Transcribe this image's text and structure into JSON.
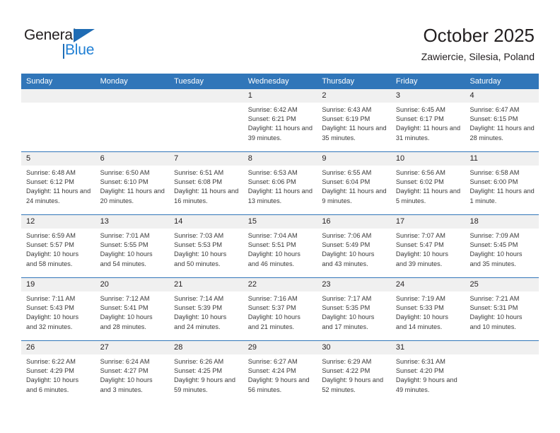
{
  "brand": {
    "word_one": "General",
    "word_two": "Blue",
    "accent_color": "#1f7fd4",
    "triangle_color": "#1f6cb4",
    "logo_icon": "triangle-icon"
  },
  "header": {
    "title": "October 2025",
    "subtitle": "Zawiercie, Silesia, Poland"
  },
  "calendar": {
    "header_bg": "#3176b9",
    "daynum_bg": "#f0f0f0",
    "weekdays": [
      "Sunday",
      "Monday",
      "Tuesday",
      "Wednesday",
      "Thursday",
      "Friday",
      "Saturday"
    ],
    "weeks": [
      [
        {
          "day": "",
          "sunrise": "",
          "sunset": "",
          "daylight": "",
          "empty": true
        },
        {
          "day": "",
          "sunrise": "",
          "sunset": "",
          "daylight": "",
          "empty": true
        },
        {
          "day": "",
          "sunrise": "",
          "sunset": "",
          "daylight": "",
          "empty": true
        },
        {
          "day": "1",
          "sunrise": "Sunrise: 6:42 AM",
          "sunset": "Sunset: 6:21 PM",
          "daylight": "Daylight: 11 hours and 39 minutes."
        },
        {
          "day": "2",
          "sunrise": "Sunrise: 6:43 AM",
          "sunset": "Sunset: 6:19 PM",
          "daylight": "Daylight: 11 hours and 35 minutes."
        },
        {
          "day": "3",
          "sunrise": "Sunrise: 6:45 AM",
          "sunset": "Sunset: 6:17 PM",
          "daylight": "Daylight: 11 hours and 31 minutes."
        },
        {
          "day": "4",
          "sunrise": "Sunrise: 6:47 AM",
          "sunset": "Sunset: 6:15 PM",
          "daylight": "Daylight: 11 hours and 28 minutes."
        }
      ],
      [
        {
          "day": "5",
          "sunrise": "Sunrise: 6:48 AM",
          "sunset": "Sunset: 6:12 PM",
          "daylight": "Daylight: 11 hours and 24 minutes."
        },
        {
          "day": "6",
          "sunrise": "Sunrise: 6:50 AM",
          "sunset": "Sunset: 6:10 PM",
          "daylight": "Daylight: 11 hours and 20 minutes."
        },
        {
          "day": "7",
          "sunrise": "Sunrise: 6:51 AM",
          "sunset": "Sunset: 6:08 PM",
          "daylight": "Daylight: 11 hours and 16 minutes."
        },
        {
          "day": "8",
          "sunrise": "Sunrise: 6:53 AM",
          "sunset": "Sunset: 6:06 PM",
          "daylight": "Daylight: 11 hours and 13 minutes."
        },
        {
          "day": "9",
          "sunrise": "Sunrise: 6:55 AM",
          "sunset": "Sunset: 6:04 PM",
          "daylight": "Daylight: 11 hours and 9 minutes."
        },
        {
          "day": "10",
          "sunrise": "Sunrise: 6:56 AM",
          "sunset": "Sunset: 6:02 PM",
          "daylight": "Daylight: 11 hours and 5 minutes."
        },
        {
          "day": "11",
          "sunrise": "Sunrise: 6:58 AM",
          "sunset": "Sunset: 6:00 PM",
          "daylight": "Daylight: 11 hours and 1 minute."
        }
      ],
      [
        {
          "day": "12",
          "sunrise": "Sunrise: 6:59 AM",
          "sunset": "Sunset: 5:57 PM",
          "daylight": "Daylight: 10 hours and 58 minutes."
        },
        {
          "day": "13",
          "sunrise": "Sunrise: 7:01 AM",
          "sunset": "Sunset: 5:55 PM",
          "daylight": "Daylight: 10 hours and 54 minutes."
        },
        {
          "day": "14",
          "sunrise": "Sunrise: 7:03 AM",
          "sunset": "Sunset: 5:53 PM",
          "daylight": "Daylight: 10 hours and 50 minutes."
        },
        {
          "day": "15",
          "sunrise": "Sunrise: 7:04 AM",
          "sunset": "Sunset: 5:51 PM",
          "daylight": "Daylight: 10 hours and 46 minutes."
        },
        {
          "day": "16",
          "sunrise": "Sunrise: 7:06 AM",
          "sunset": "Sunset: 5:49 PM",
          "daylight": "Daylight: 10 hours and 43 minutes."
        },
        {
          "day": "17",
          "sunrise": "Sunrise: 7:07 AM",
          "sunset": "Sunset: 5:47 PM",
          "daylight": "Daylight: 10 hours and 39 minutes."
        },
        {
          "day": "18",
          "sunrise": "Sunrise: 7:09 AM",
          "sunset": "Sunset: 5:45 PM",
          "daylight": "Daylight: 10 hours and 35 minutes."
        }
      ],
      [
        {
          "day": "19",
          "sunrise": "Sunrise: 7:11 AM",
          "sunset": "Sunset: 5:43 PM",
          "daylight": "Daylight: 10 hours and 32 minutes."
        },
        {
          "day": "20",
          "sunrise": "Sunrise: 7:12 AM",
          "sunset": "Sunset: 5:41 PM",
          "daylight": "Daylight: 10 hours and 28 minutes."
        },
        {
          "day": "21",
          "sunrise": "Sunrise: 7:14 AM",
          "sunset": "Sunset: 5:39 PM",
          "daylight": "Daylight: 10 hours and 24 minutes."
        },
        {
          "day": "22",
          "sunrise": "Sunrise: 7:16 AM",
          "sunset": "Sunset: 5:37 PM",
          "daylight": "Daylight: 10 hours and 21 minutes."
        },
        {
          "day": "23",
          "sunrise": "Sunrise: 7:17 AM",
          "sunset": "Sunset: 5:35 PM",
          "daylight": "Daylight: 10 hours and 17 minutes."
        },
        {
          "day": "24",
          "sunrise": "Sunrise: 7:19 AM",
          "sunset": "Sunset: 5:33 PM",
          "daylight": "Daylight: 10 hours and 14 minutes."
        },
        {
          "day": "25",
          "sunrise": "Sunrise: 7:21 AM",
          "sunset": "Sunset: 5:31 PM",
          "daylight": "Daylight: 10 hours and 10 minutes."
        }
      ],
      [
        {
          "day": "26",
          "sunrise": "Sunrise: 6:22 AM",
          "sunset": "Sunset: 4:29 PM",
          "daylight": "Daylight: 10 hours and 6 minutes."
        },
        {
          "day": "27",
          "sunrise": "Sunrise: 6:24 AM",
          "sunset": "Sunset: 4:27 PM",
          "daylight": "Daylight: 10 hours and 3 minutes."
        },
        {
          "day": "28",
          "sunrise": "Sunrise: 6:26 AM",
          "sunset": "Sunset: 4:25 PM",
          "daylight": "Daylight: 9 hours and 59 minutes."
        },
        {
          "day": "29",
          "sunrise": "Sunrise: 6:27 AM",
          "sunset": "Sunset: 4:24 PM",
          "daylight": "Daylight: 9 hours and 56 minutes."
        },
        {
          "day": "30",
          "sunrise": "Sunrise: 6:29 AM",
          "sunset": "Sunset: 4:22 PM",
          "daylight": "Daylight: 9 hours and 52 minutes."
        },
        {
          "day": "31",
          "sunrise": "Sunrise: 6:31 AM",
          "sunset": "Sunset: 4:20 PM",
          "daylight": "Daylight: 9 hours and 49 minutes."
        },
        {
          "day": "",
          "sunrise": "",
          "sunset": "",
          "daylight": "",
          "empty": true
        }
      ]
    ]
  }
}
